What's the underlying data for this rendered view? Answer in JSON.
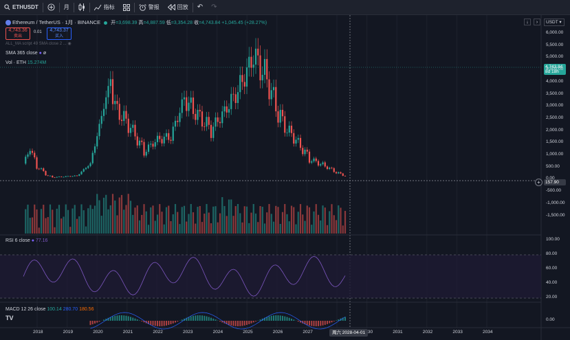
{
  "toolbar": {
    "symbol": "ETHUSDT",
    "interval": "月",
    "indicators": "指标",
    "alerts": "警报",
    "replay": "回放",
    "add": "+",
    "undo": "↶",
    "redo": "↷"
  },
  "header": {
    "title": "Ethereum / TetherUS · 1月 · BINANCE",
    "ohlc": {
      "o_label": "开",
      "o": "=3,698.39",
      "h_label": "高",
      "h": "=4,887.59",
      "l_label": "低",
      "l": "=3,354.28",
      "c_label": "收",
      "c": "=4,743.84",
      "chg": "+1,045.45 (+28.27%)"
    },
    "sell_price": "4,743.36",
    "sell_label": "卖出",
    "spread": "0.01",
    "buy_price": "4,743.37",
    "buy_label": "买入",
    "script": "ALL_MA script 49 SMA close 2 ...",
    "sma": "SMA 365 close",
    "vol_label": "Vol · ETH",
    "vol_value": "15.274M"
  },
  "currency": "USDT",
  "price_axis": [
    "6,000.00",
    "5,500.00",
    "5,000.00",
    "4,500.00",
    "4,000.00",
    "3,500.00",
    "3,000.00",
    "2,500.00",
    "2,000.00",
    "1,500.00",
    "1,000.00",
    "500.00",
    "0.00",
    "-500.00",
    "-1,000.00",
    "-1,500.00"
  ],
  "price_tag": {
    "value": "4,743.84",
    "countdown": "8d 18h"
  },
  "crosshair_price": "157.90",
  "rsi": {
    "label": "RSI 6 close",
    "value": "77.16",
    "axis": [
      "100.00",
      "80.00",
      "60.00",
      "40.00",
      "20.00"
    ]
  },
  "macd": {
    "label": "MACD 12 26 close",
    "v1": "100.14",
    "v2": "280.70",
    "v3": "180.56",
    "axis": [
      "0.00"
    ]
  },
  "time_axis": [
    "2018",
    "2019",
    "2020",
    "2021",
    "2022",
    "2023",
    "2024",
    "2025",
    "2026",
    "2027",
    "029",
    "2030",
    "2031",
    "2032",
    "2033",
    "2034"
  ],
  "crosshair_date": "周六 2028-04-01",
  "logo": "TV",
  "colors": {
    "up": "#26a69a",
    "down": "#ef5350",
    "bg": "#131722",
    "accent": "#2962ff"
  }
}
